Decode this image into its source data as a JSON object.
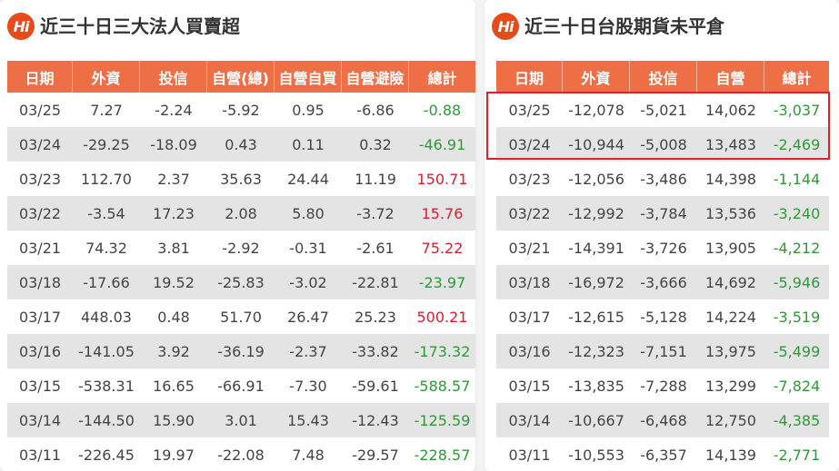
{
  "left": {
    "logo": "Hi",
    "title": "近三十日三大法人買賣超",
    "headers": [
      "日期",
      "外資",
      "投信",
      "自營(總)",
      "自營自買",
      "自營避險",
      "總計"
    ],
    "rows": [
      [
        "03/25",
        "7.27",
        "-2.24",
        "-5.92",
        "0.95",
        "-6.86",
        "-0.88"
      ],
      [
        "03/24",
        "-29.25",
        "-18.09",
        "0.43",
        "0.11",
        "0.32",
        "-46.91"
      ],
      [
        "03/23",
        "112.70",
        "2.37",
        "35.63",
        "24.44",
        "11.19",
        "150.71"
      ],
      [
        "03/22",
        "-3.54",
        "17.23",
        "2.08",
        "5.80",
        "-3.72",
        "15.76"
      ],
      [
        "03/21",
        "74.32",
        "3.81",
        "-2.92",
        "-0.31",
        "-2.61",
        "75.22"
      ],
      [
        "03/18",
        "-17.66",
        "19.52",
        "-25.83",
        "-3.02",
        "-22.81",
        "-23.97"
      ],
      [
        "03/17",
        "448.03",
        "0.48",
        "51.70",
        "26.47",
        "25.23",
        "500.21"
      ],
      [
        "03/16",
        "-141.05",
        "3.92",
        "-36.19",
        "-2.37",
        "-33.82",
        "-173.32"
      ],
      [
        "03/15",
        "-538.31",
        "16.65",
        "-66.91",
        "-7.30",
        "-59.61",
        "-588.57"
      ],
      [
        "03/14",
        "-144.50",
        "15.90",
        "3.01",
        "15.43",
        "-12.43",
        "-125.59"
      ],
      [
        "03/11",
        "-226.45",
        "19.97",
        "-22.08",
        "7.48",
        "-29.57",
        "-228.57"
      ]
    ]
  },
  "right": {
    "logo": "Hi",
    "title": "近三十日台股期貨未平倉",
    "headers": [
      "日期",
      "外資",
      "投信",
      "自營",
      "總計"
    ],
    "rows": [
      [
        "03/25",
        "-12,078",
        "-5,021",
        "14,062",
        "-3,037"
      ],
      [
        "03/24",
        "-10,944",
        "-5,008",
        "13,483",
        "-2,469"
      ],
      [
        "03/23",
        "-12,056",
        "-3,486",
        "14,398",
        "-1,144"
      ],
      [
        "03/22",
        "-12,992",
        "-3,784",
        "13,536",
        "-3,240"
      ],
      [
        "03/21",
        "-14,391",
        "-3,726",
        "13,905",
        "-4,212"
      ],
      [
        "03/18",
        "-16,972",
        "-3,666",
        "14,692",
        "-5,946"
      ],
      [
        "03/17",
        "-12,615",
        "-5,128",
        "14,224",
        "-3,519"
      ],
      [
        "03/16",
        "-12,323",
        "-7,151",
        "13,975",
        "-5,499"
      ],
      [
        "03/15",
        "-13,835",
        "-7,288",
        "13,299",
        "-7,824"
      ],
      [
        "03/14",
        "-10,667",
        "-6,468",
        "12,750",
        "-4,385"
      ],
      [
        "03/11",
        "-10,553",
        "-6,357",
        "14,139",
        "-2,771"
      ]
    ]
  },
  "colors": {
    "header_bg": "#ee6e45",
    "positive": "#d8202f",
    "negative": "#2e9a35",
    "highlight": "#e0202a"
  }
}
